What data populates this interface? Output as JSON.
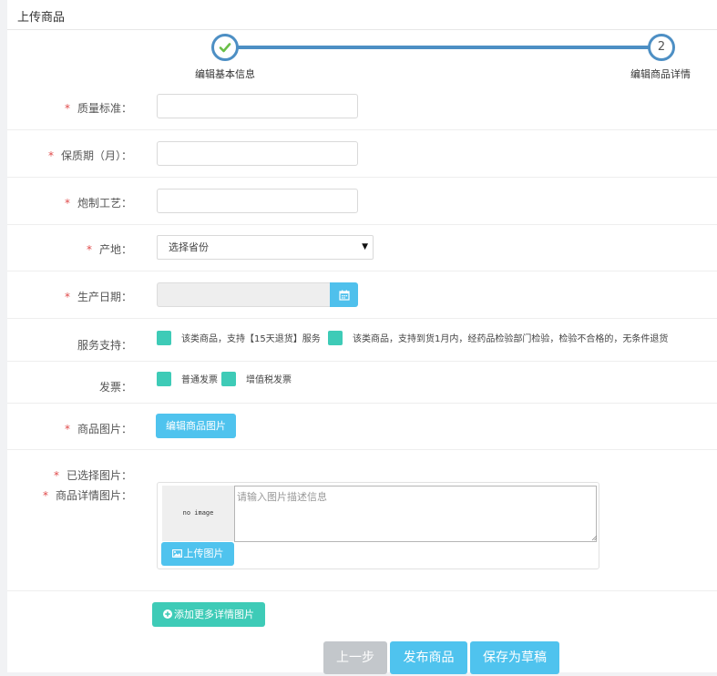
{
  "panel": {
    "title": "上传商品"
  },
  "wizard": {
    "step1": {
      "label": "编辑基本信息"
    },
    "step2": {
      "number": "2",
      "label": "编辑商品详情"
    }
  },
  "form": {
    "required_mark": "*",
    "quality": {
      "label": "质量标准：",
      "value": ""
    },
    "shelf_life": {
      "label": "保质期（月）：",
      "value": ""
    },
    "process": {
      "label": "炮制工艺：",
      "value": ""
    },
    "origin": {
      "label": "产地：",
      "selected": "选择省份"
    },
    "production_date": {
      "label": "生产日期：",
      "value": ""
    },
    "service": {
      "label": "服务支持：",
      "option1": "该类商品，支持【15天退货】服务",
      "option2": "该类商品，支持到货1月内，经药品检验部门检验，检验不合格的，无条件退货"
    },
    "invoice": {
      "label": "发票：",
      "option1": "普通发票",
      "option2": "增值税发票"
    },
    "product_image": {
      "label": "商品图片：",
      "button": "编辑商品图片"
    },
    "selected_image": {
      "label": "已选择图片："
    },
    "detail_image": {
      "label": "商品详情图片：",
      "no_image": "no image",
      "placeholder": "请输入图片描述信息",
      "upload_button": "上传图片"
    },
    "add_more_button": "添加更多详情图片"
  },
  "actions": {
    "prev": "上一步",
    "publish": "发布商品",
    "save_draft": "保存为草稿"
  },
  "colors": {
    "step_blue": "#4d8fc4",
    "check_green": "#6abf47",
    "primary_blue": "#4fc3ee",
    "teal": "#3ecbb7",
    "disabled_gray": "#c3c7cb",
    "required_red": "#e04b4b"
  }
}
